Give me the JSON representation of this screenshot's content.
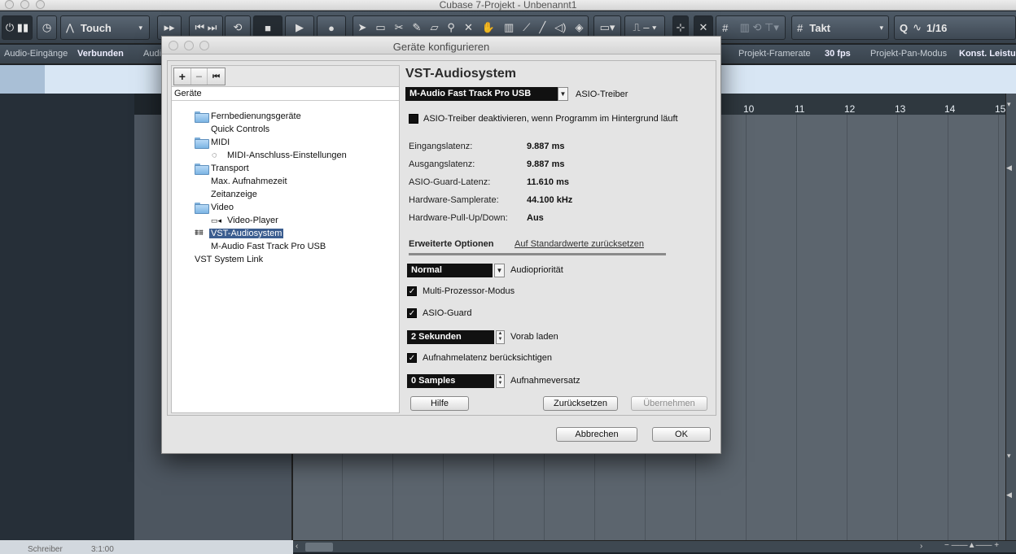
{
  "window": {
    "title": "Cubase 7-Projekt - Unbenannt1"
  },
  "toolbar": {
    "automation_mode": "Touch",
    "grid_type": "Takt",
    "quantize_label": "Q",
    "quantize_value": "1/16"
  },
  "infoline": {
    "audio_inputs_label": "Audio-Eingänge",
    "audio_inputs_value": "Verbunden",
    "audio_truncated": "Audi",
    "framerate_label": "Projekt-Framerate",
    "framerate_value": "30 fps",
    "pan_label": "Projekt-Pan-Modus",
    "pan_value": "Konst. Leistu"
  },
  "ruler": {
    "bars": [
      "10",
      "11",
      "12",
      "13",
      "14",
      "15"
    ]
  },
  "statusbar": {
    "left": "Schreiber",
    "right": "3:1:00"
  },
  "dialog": {
    "title": "Geräte konfigurieren",
    "tree": {
      "toolbar": {
        "add": "+",
        "remove": "−",
        "reset": "⏮"
      },
      "header": "Geräte",
      "items": [
        {
          "label": "Fernbedienungsgeräte",
          "icon": "folder-icon"
        },
        {
          "label": "Quick Controls",
          "icon": ""
        },
        {
          "label": "MIDI",
          "icon": "folder-icon"
        },
        {
          "label": "MIDI-Anschluss-Einstellungen",
          "icon": "midi-port-icon"
        },
        {
          "label": "Transport",
          "icon": "folder-icon"
        },
        {
          "label": "Max. Aufnahmezeit",
          "icon": ""
        },
        {
          "label": "Zeitanzeige",
          "icon": ""
        },
        {
          "label": "Video",
          "icon": "folder-icon"
        },
        {
          "label": "Video-Player",
          "icon": "video-icon"
        },
        {
          "label": "VST-Audiosystem",
          "icon": "audio-wave-icon",
          "selected": true
        },
        {
          "label": "M-Audio Fast Track Pro USB",
          "icon": ""
        },
        {
          "label": "VST System Link",
          "icon": ""
        }
      ]
    },
    "panel": {
      "heading": "VST-Audiosystem",
      "driver_value": "M-Audio Fast Track Pro USB",
      "driver_label": "ASIO-Treiber",
      "deactivate_checkbox": {
        "label": "ASIO-Treiber deaktivieren, wenn Programm im Hintergrund läuft",
        "checked": false
      },
      "stats": [
        {
          "label": "Eingangslatenz:",
          "value": "9.887 ms"
        },
        {
          "label": "Ausgangslatenz:",
          "value": "9.887 ms"
        },
        {
          "label": "ASIO-Guard-Latenz:",
          "value": "11.610 ms"
        },
        {
          "label": "Hardware-Samplerate:",
          "value": "44.100 kHz"
        },
        {
          "label": "Hardware-Pull-Up/Down:",
          "value": "Aus"
        }
      ],
      "tab_advanced": "Erweiterte Optionen",
      "tab_reset_link": "Auf Standardwerte zurücksetzen",
      "priority_value": "Normal",
      "priority_label": "Audiopriorität",
      "multiprocessor": {
        "label": "Multi-Prozessor-Modus",
        "checked": true
      },
      "asio_guard": {
        "label": "ASIO-Guard",
        "checked": true
      },
      "preload_value": "2 Sekunden",
      "preload_label": "Vorab laden",
      "record_latency": {
        "label": "Aufnahmelatenz berücksichtigen",
        "checked": true
      },
      "record_offset_value": "0 Samples",
      "record_offset_label": "Aufnahmeversatz",
      "help_button": "Hilfe",
      "reset_button": "Zurücksetzen",
      "apply_button": "Übernehmen"
    },
    "cancel_button": "Abbrechen",
    "ok_button": "OK"
  }
}
